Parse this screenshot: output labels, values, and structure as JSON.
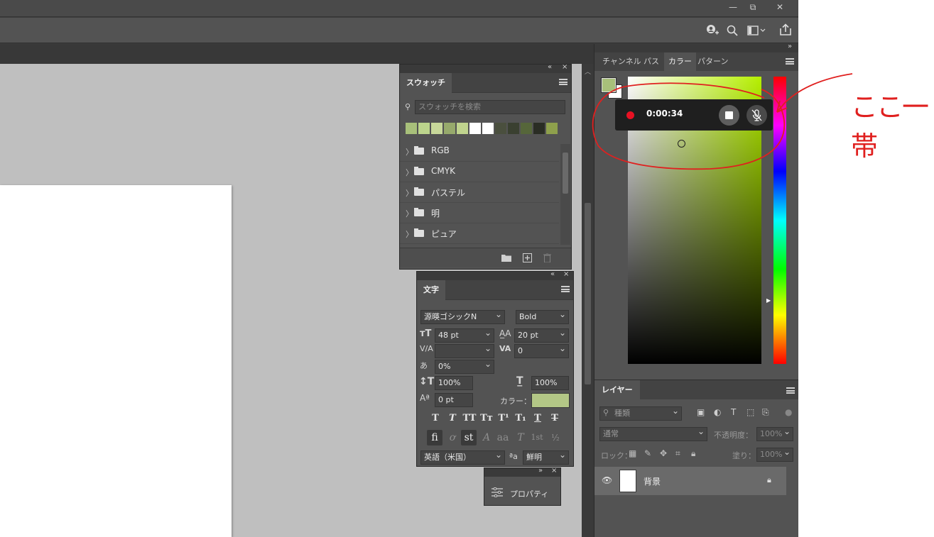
{
  "window": {
    "minimize": "—",
    "restore": "⧉",
    "close": "✕"
  },
  "toolbar_icons": [
    "user-icon",
    "search-icon",
    "workspace-icon",
    "share-icon"
  ],
  "swatches_panel": {
    "tab": "スウォッチ",
    "search_placeholder": "スウォッチを検索",
    "recent_colors": [
      "#a8c07a",
      "#bcd48c",
      "#c8d89a",
      "#97aa6c",
      "#c0d48e",
      "#ffffff",
      "#ffffff",
      "#4a4f3e",
      "#3a4030",
      "#56663a",
      "#2a2d24",
      "#8ea04c"
    ],
    "folders": [
      "RGB",
      "CMYK",
      "パステル",
      "明",
      "ピュア"
    ]
  },
  "character_panel": {
    "tab": "文字",
    "font_family": "源暎ゴシックN",
    "font_style": "Bold",
    "font_size": "48 pt",
    "leading": "20 pt",
    "kerning": "",
    "tracking": "0",
    "tsume": "0%",
    "vertical_scale": "100%",
    "horizontal_scale": "100%",
    "baseline_shift": "0 pt",
    "color_label": "カラー：",
    "color_value": "#b3c786",
    "style_buttons": [
      "T",
      "T",
      "TT",
      "Tт",
      "T¹",
      "T₁",
      "T",
      "T"
    ],
    "opentype_buttons": [
      "fi",
      "ơ",
      "st",
      "A",
      "aa",
      "T",
      "1st",
      "½"
    ],
    "language": "英語（米国）",
    "antialias_icon_label": "ªa",
    "antialias": "鮮明"
  },
  "properties_panel": {
    "label": "プロパティ"
  },
  "color_panel": {
    "tabs": [
      "チャンネル",
      "パス",
      "カラー",
      "パターン"
    ],
    "active_tab": "カラー",
    "foreground": "#a8c07a",
    "background": "#ffffff",
    "hue_color": "#b6f000"
  },
  "recording": {
    "time": "0:00:34"
  },
  "layers_panel": {
    "tab": "レイヤー",
    "filter_label": "種類",
    "blend_mode": "通常",
    "opacity_label": "不透明度：",
    "opacity_value": "100%",
    "lock_label": "ロック：",
    "fill_label": "塗り：",
    "fill_value": "100%",
    "layers": [
      {
        "name": "背景"
      }
    ]
  },
  "annotation": {
    "text": "ここ一帯"
  }
}
